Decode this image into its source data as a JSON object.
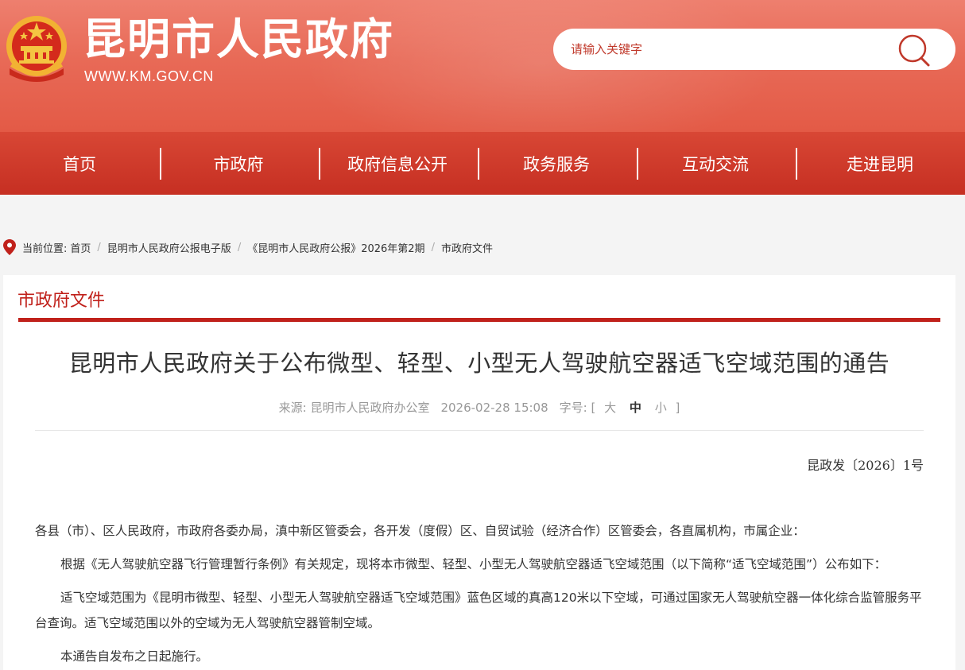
{
  "header": {
    "site_title": "昆明市人民政府",
    "site_url": "WWW.KM.GOV.CN",
    "search_placeholder": "请输入关键字"
  },
  "nav": {
    "items": [
      {
        "label": "首页"
      },
      {
        "label": "市政府"
      },
      {
        "label": "政府信息公开"
      },
      {
        "label": "政务服务"
      },
      {
        "label": "互动交流"
      },
      {
        "label": "走进昆明"
      }
    ]
  },
  "breadcrumb": {
    "label": "当前位置:",
    "items": [
      "首页",
      "昆明市人民政府公报电子版",
      "《昆明市人民政府公报》2026年第2期",
      "市政府文件"
    ],
    "separator": "/"
  },
  "section": {
    "title": "市政府文件"
  },
  "article": {
    "title": "昆明市人民政府关于公布微型、轻型、小型无人驾驶航空器适飞空域范围的通告",
    "source": "来源: 昆明市人民政府办公室",
    "date": "2026-02-28 15:08",
    "font_size_label": "字号:",
    "bracket_open": "[",
    "bracket_close": "]",
    "font_sizes": {
      "large": "大",
      "medium": "中",
      "small": "小"
    },
    "doc_number": "昆政发〔2026〕1号",
    "paragraphs": [
      "各县（市）、区人民政府，市政府各委办局，滇中新区管委会，各开发（度假）区、自贸试验（经济合作）区管委会，各直属机构，市属企业：",
      "根据《无人驾驶航空器飞行管理暂行条例》有关规定，现将本市微型、轻型、小型无人驾驶航空器适飞空域范围（以下简称“适飞空域范围”）公布如下：",
      "适飞空域范围为《昆明市微型、轻型、小型无人驾驶航空器适飞空域范围》蓝色区域的真高120米以下空域，可通过国家无人驾驶航空器一体化综合监管服务平台查询。适飞空域范围以外的空域为无人驾驶航空器管制空域。",
      "本通告自发布之日起施行。"
    ]
  },
  "colors": {
    "header_top": "#ee7f6e",
    "nav": "#c62f22",
    "accent": "#c0211b"
  },
  "icons": {
    "emblem": "national-emblem-icon",
    "search": "search-icon",
    "location": "location-pin-icon"
  }
}
